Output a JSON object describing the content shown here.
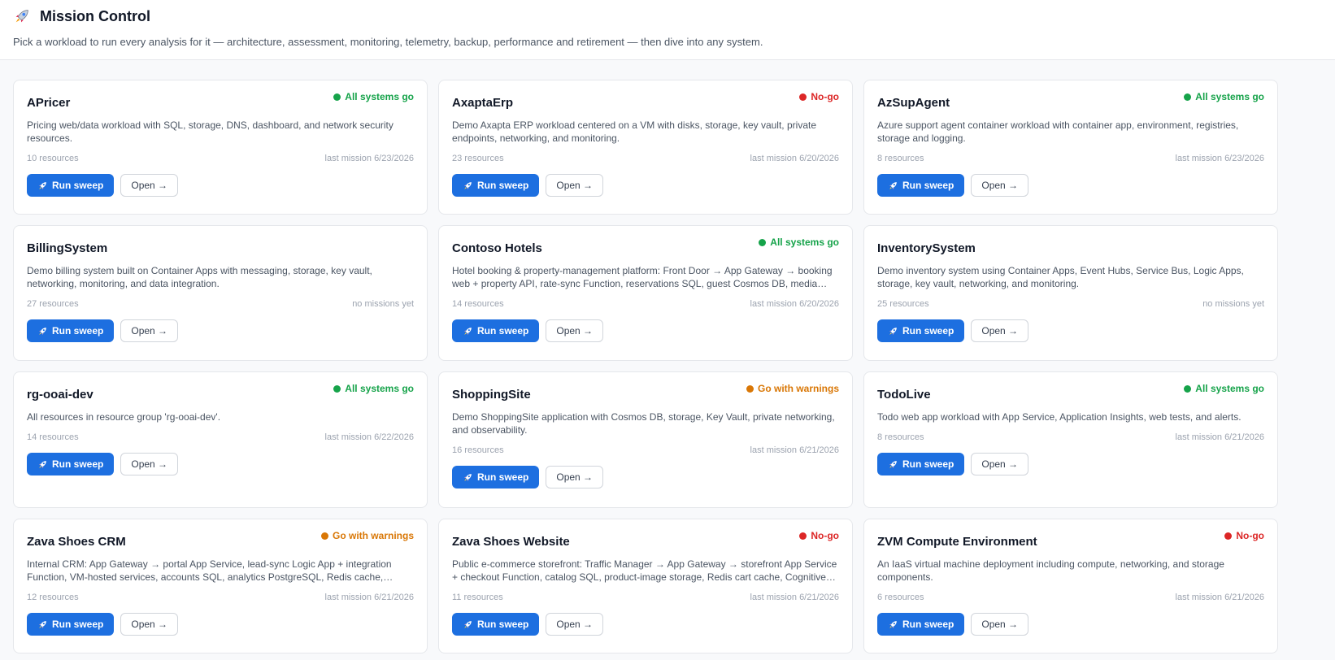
{
  "header": {
    "title": "Mission Control",
    "subtitle": "Pick a workload to run every analysis for it — architecture, assessment, monitoring, telemetry, backup, performance and retirement — then dive into any system."
  },
  "labels": {
    "run": "Run sweep",
    "open": "Open →"
  },
  "status_colors": {
    "ok": "#16a34a",
    "nogo": "#dc2626",
    "warn": "#d97706"
  },
  "accent": "#1d6fe0",
  "workloads": [
    {
      "name": "APricer",
      "status": "All systems go",
      "status_type": "ok",
      "description": "Pricing web/data workload with SQL, storage, DNS, dashboard, and network security resources.",
      "resources": "10 resources",
      "last_mission": "last mission 6/23/2026"
    },
    {
      "name": "AxaptaErp",
      "status": "No-go",
      "status_type": "nogo",
      "description": "Demo Axapta ERP workload centered on a VM with disks, storage, key vault, private endpoints, networking, and monitoring.",
      "resources": "23 resources",
      "last_mission": "last mission 6/20/2026"
    },
    {
      "name": "AzSupAgent",
      "status": "All systems go",
      "status_type": "ok",
      "description": "Azure support agent container workload with container app, environment, registries, storage and logging.",
      "resources": "8 resources",
      "last_mission": "last mission 6/23/2026"
    },
    {
      "name": "BillingSystem",
      "status": "",
      "status_type": "none",
      "description": "Demo billing system built on Container Apps with messaging, storage, key vault, networking, monitoring, and data integration.",
      "resources": "27 resources",
      "last_mission": "no missions yet"
    },
    {
      "name": "Contoso Hotels",
      "status": "All systems go",
      "status_type": "ok",
      "description": "Hotel booking & property-management platform: Front Door → App Gateway → booking web + property API, rate-sync Function, reservations SQL, guest Cosmos DB, media storage, Redis cache.",
      "resources": "14 resources",
      "last_mission": "last mission 6/20/2026"
    },
    {
      "name": "InventorySystem",
      "status": "",
      "status_type": "none",
      "description": "Demo inventory system using Container Apps, Event Hubs, Service Bus, Logic Apps, storage, key vault, networking, and monitoring.",
      "resources": "25 resources",
      "last_mission": "no missions yet"
    },
    {
      "name": "rg-ooai-dev",
      "status": "All systems go",
      "status_type": "ok",
      "description": "All resources in resource group 'rg-ooai-dev'.",
      "resources": "14 resources",
      "last_mission": "last mission 6/22/2026"
    },
    {
      "name": "ShoppingSite",
      "status": "Go with warnings",
      "status_type": "warn",
      "description": "Demo ShoppingSite application with Cosmos DB, storage, Key Vault, private networking, and observability.",
      "resources": "16 resources",
      "last_mission": "last mission 6/21/2026"
    },
    {
      "name": "TodoLive",
      "status": "All systems go",
      "status_type": "ok",
      "description": "Todo web app workload with App Service, Application Insights, web tests, and alerts.",
      "resources": "8 resources",
      "last_mission": "last mission 6/21/2026"
    },
    {
      "name": "Zava Shoes CRM",
      "status": "Go with warnings",
      "status_type": "warn",
      "description": "Internal CRM: App Gateway → portal App Service, lead-sync Logic App + integration Function, VM-hosted services, accounts SQL, analytics PostgreSQL, Redis cache, document storage.",
      "resources": "12 resources",
      "last_mission": "last mission 6/21/2026"
    },
    {
      "name": "Zava Shoes Website",
      "status": "No-go",
      "status_type": "nogo",
      "description": "Public e-commerce storefront: Traffic Manager → App Gateway → storefront App Service + checkout Function, catalog SQL, product-image storage, Redis cart cache, Cognitive Search and monitoring.",
      "resources": "11 resources",
      "last_mission": "last mission 6/21/2026"
    },
    {
      "name": "ZVM Compute Environment",
      "status": "No-go",
      "status_type": "nogo",
      "description": "An IaaS virtual machine deployment including compute, networking, and storage components.",
      "resources": "6 resources",
      "last_mission": "last mission 6/21/2026"
    }
  ]
}
